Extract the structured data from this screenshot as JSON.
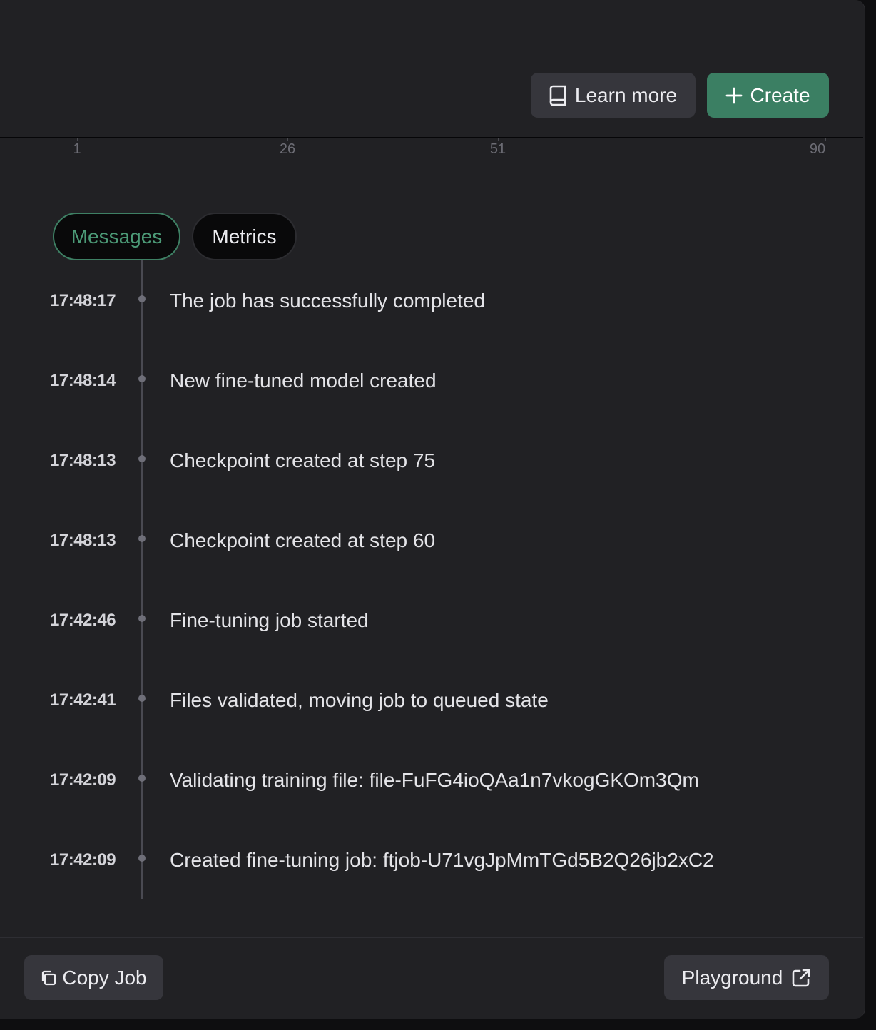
{
  "header": {
    "learn_more_label": "Learn more",
    "create_label": "Create"
  },
  "axis": {
    "ticks": [
      "1",
      "26",
      "51",
      "90"
    ]
  },
  "tabs": [
    {
      "label": "Messages",
      "active": true
    },
    {
      "label": "Metrics",
      "active": false
    }
  ],
  "events": [
    {
      "time": "17:48:17",
      "message": "The job has successfully completed"
    },
    {
      "time": "17:48:14",
      "message": "New fine-tuned model created"
    },
    {
      "time": "17:48:13",
      "message": "Checkpoint created at step 75"
    },
    {
      "time": "17:48:13",
      "message": "Checkpoint created at step 60"
    },
    {
      "time": "17:42:46",
      "message": "Fine-tuning job started"
    },
    {
      "time": "17:42:41",
      "message": "Files validated, moving job to queued state"
    },
    {
      "time": "17:42:09",
      "message": "Validating training file: file-FuFG4ioQAa1n7vkogGKOm3Qm"
    },
    {
      "time": "17:42:09",
      "message": "Created fine-tuning job: ftjob-U71vgJpMmTGd5B2Q26jb2xC2"
    }
  ],
  "footer": {
    "copy_label": "Copy Job",
    "playground_label": "Playground"
  },
  "icons": {
    "learn": "book-icon",
    "create": "plus-icon",
    "copy": "copy-icon",
    "playground": "external-link-icon"
  },
  "colors": {
    "accent": "#3b7f63",
    "accent_text": "#4c9a77",
    "panel": "#212124",
    "button": "#36363c"
  }
}
